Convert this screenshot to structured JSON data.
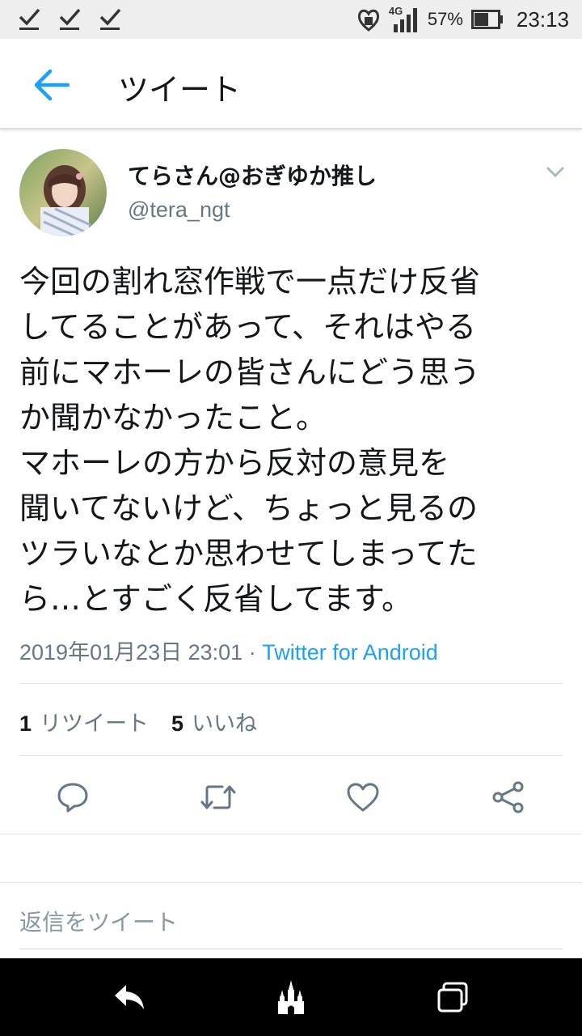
{
  "status_bar": {
    "notification_icons": [
      "check-icon",
      "check-icon",
      "check-icon"
    ],
    "network": "4G",
    "battery": "57%",
    "time": "23:13"
  },
  "header": {
    "back_icon": "arrow-left-icon",
    "title": "ツイート"
  },
  "tweet": {
    "display_name": "てらさん@おぎゆか推し",
    "handle": "@tera_ngt",
    "text_lines": [
      "今回の割れ窓作戦で一点だけ反省",
      "してることがあって、それはやる",
      "前にマホーレの皆さんにどう思う",
      "か聞かなかったこと。",
      "マホーレの方から反対の意見を",
      "聞いてないけど、ちょっと見るの",
      "ツラいなとか思わせてしまってた",
      "ら…とすごく反省してます。"
    ],
    "timestamp": "2019年01月23日 23:01",
    "separator": " · ",
    "source": "Twitter for Android",
    "retweet_count": "1",
    "retweet_label": "リツイート",
    "like_count": "5",
    "like_label": "いいね"
  },
  "reply": {
    "placeholder": "返信をツイート"
  },
  "colors": {
    "accent": "#1da1f2",
    "secondary_text": "#657786",
    "text": "#14171a"
  }
}
